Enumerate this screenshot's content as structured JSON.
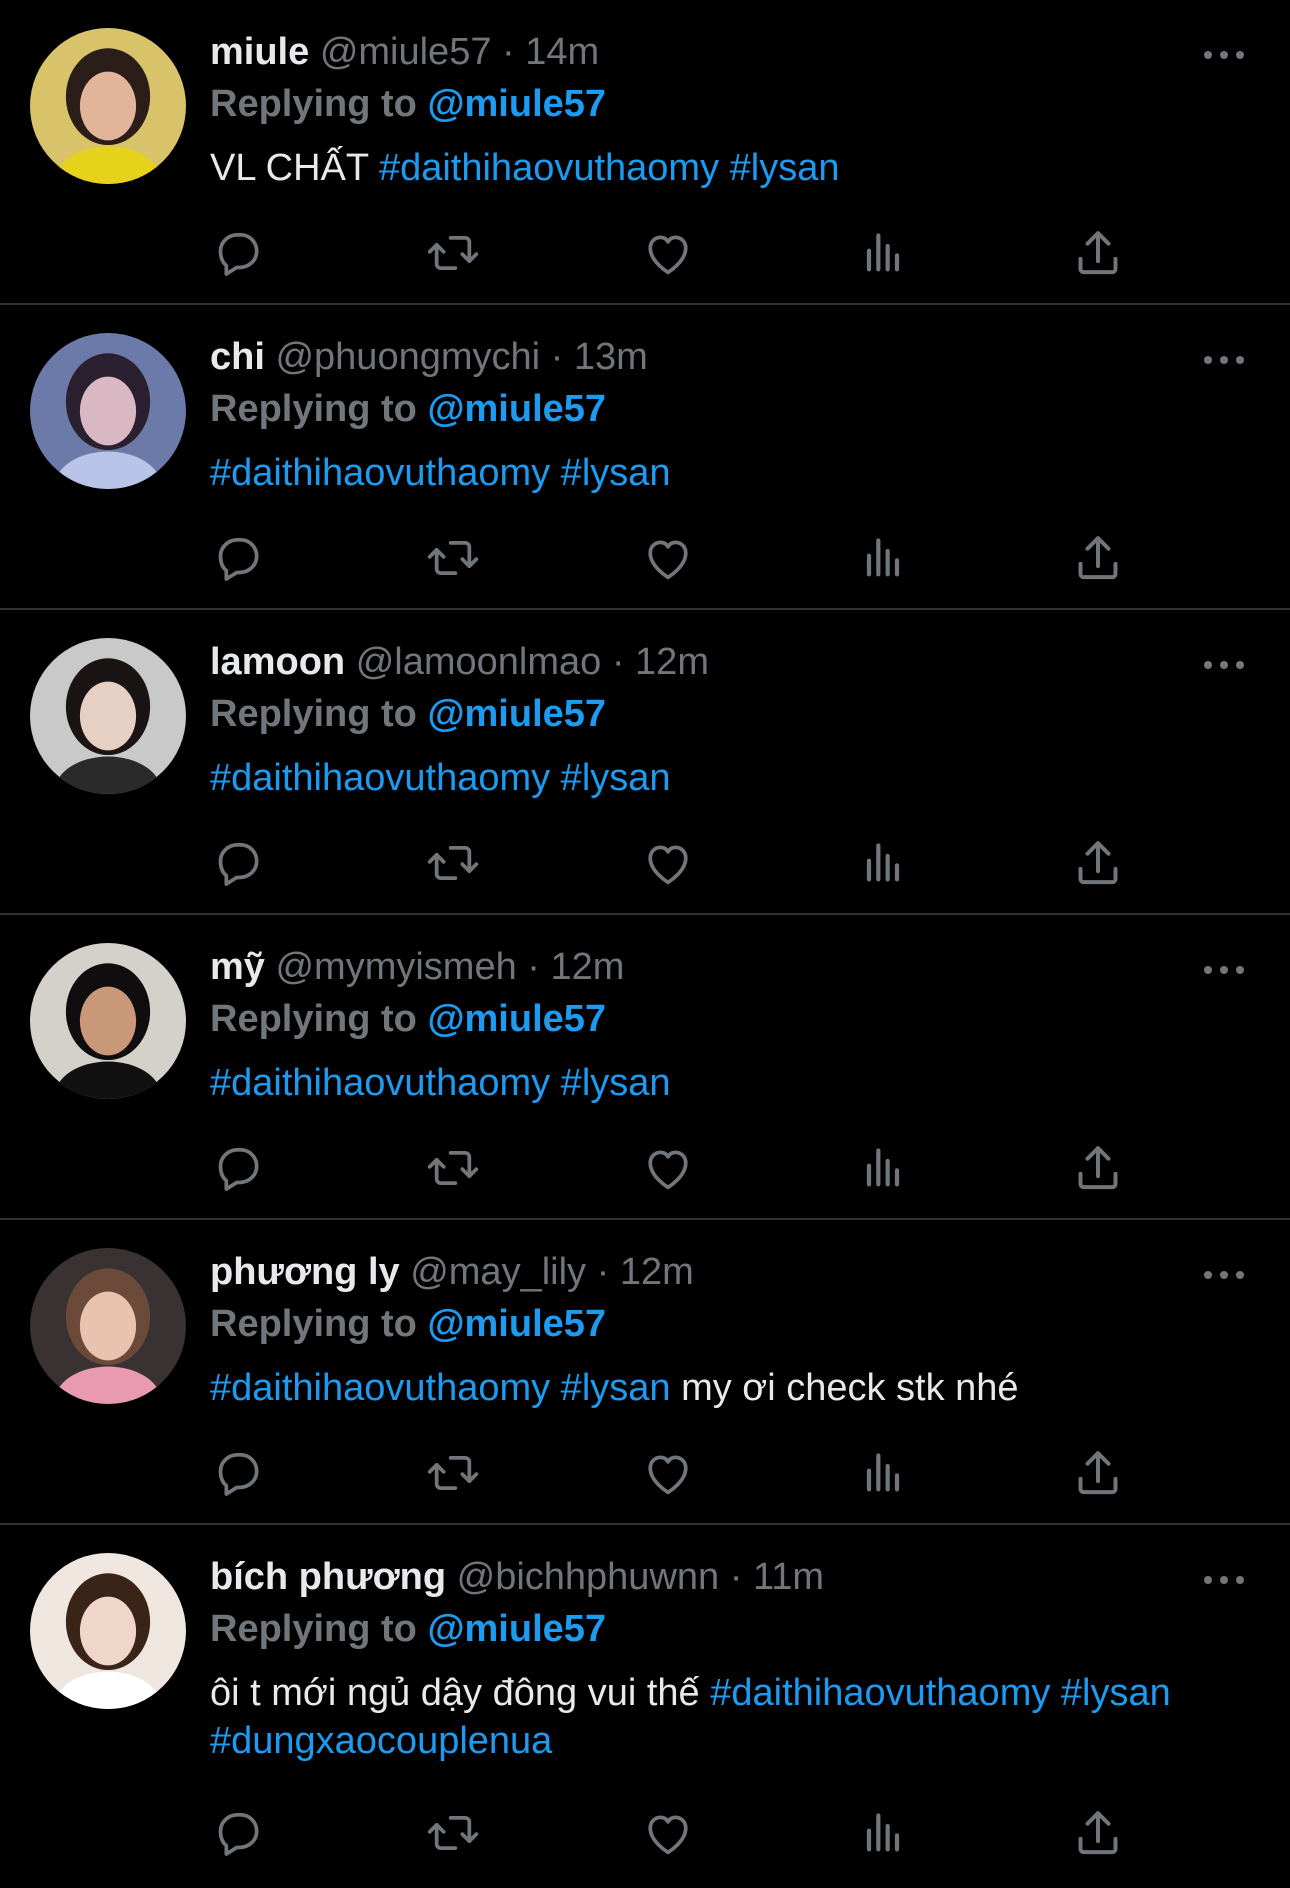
{
  "tweets": [
    {
      "name": "miule",
      "handle": "@miule57",
      "dot": "·",
      "time": "14m",
      "replying_prefix": "Replying to",
      "replying_to": "@miule57",
      "text_before": "VL CHẤT ",
      "tags": "#daithihaovuthaomy #lysan",
      "text_after": "",
      "avatar": {
        "bg": "#d8c36a",
        "skin": "#e2b59a",
        "hair": "#2b1d17",
        "accent": "#e6d21a"
      }
    },
    {
      "name": "chi",
      "handle": "@phuongmychi",
      "dot": "·",
      "time": "13m",
      "replying_prefix": "Replying to",
      "replying_to": "@miule57",
      "text_before": "",
      "tags": "#daithihaovuthaomy #lysan",
      "text_after": "",
      "avatar": {
        "bg": "#6b7aa8",
        "skin": "#d9b8c4",
        "hair": "#2a2030",
        "accent": "#b8c4e8"
      }
    },
    {
      "name": "lamoon",
      "handle": "@lamoonlmao",
      "dot": "·",
      "time": "12m",
      "replying_prefix": "Replying to",
      "replying_to": "@miule57",
      "text_before": "",
      "tags": "#daithihaovuthaomy #lysan",
      "text_after": "",
      "avatar": {
        "bg": "#c9c9c9",
        "skin": "#e6d0c4",
        "hair": "#1a1414",
        "accent": "#2a2a2a"
      }
    },
    {
      "name": "mỹ",
      "handle": "@mymyismeh",
      "dot": "·",
      "time": "12m",
      "replying_prefix": "Replying to",
      "replying_to": "@miule57",
      "text_before": "",
      "tags": "#daithihaovuthaomy #lysan",
      "text_after": "",
      "avatar": {
        "bg": "#d4d1cb",
        "skin": "#c99878",
        "hair": "#0f0d0d",
        "accent": "#111111"
      }
    },
    {
      "name": "phương ly",
      "handle": "@may_lily",
      "dot": "·",
      "time": "12m",
      "replying_prefix": "Replying to",
      "replying_to": "@miule57",
      "text_before": "",
      "tags": "#daithihaovuthaomy #lysan",
      "text_after": " my ơi check stk nhé",
      "avatar": {
        "bg": "#3a3232",
        "skin": "#e8c3b0",
        "hair": "#6b4a3a",
        "accent": "#e89ab0"
      }
    },
    {
      "name": "bích phương",
      "handle": "@bichhphuwnn",
      "dot": "·",
      "time": "11m",
      "replying_prefix": "Replying to",
      "replying_to": "@miule57",
      "text_before": "ôi t mới ngủ dậy đông vui thế ",
      "tags": "#daithihaovuthaomy #lysan #dungxaocouplenua",
      "text_after": "",
      "avatar": {
        "bg": "#efe6e0",
        "skin": "#f0d6c8",
        "hair": "#3a2418",
        "accent": "#ffffff"
      }
    }
  ],
  "icons": {
    "reply": "reply-bubble-icon",
    "retweet": "retweet-icon",
    "like": "heart-icon",
    "views": "views-bar-chart-icon",
    "share": "share-upload-icon",
    "more": "more-dots-icon"
  },
  "colors": {
    "background": "#000000",
    "text": "#e7e9ea",
    "muted": "#71767b",
    "accent": "#1d9bf0",
    "divider": "#2f3336"
  }
}
